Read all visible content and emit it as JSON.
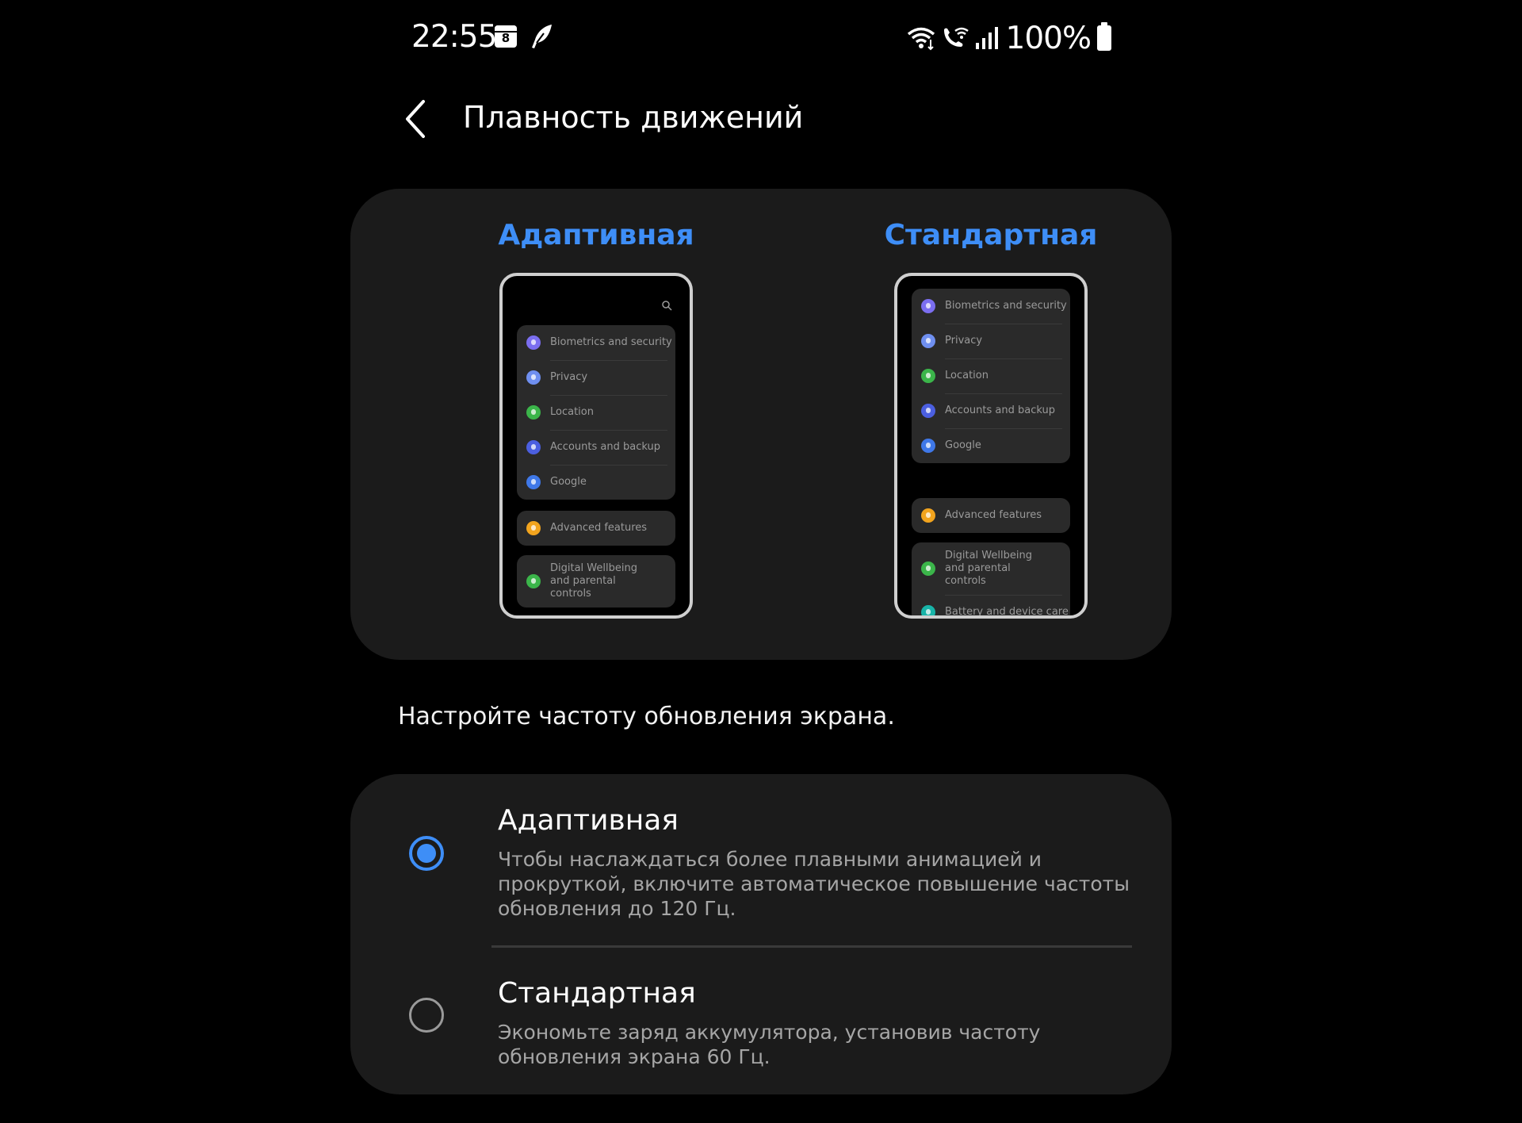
{
  "status_bar": {
    "time": "22:55",
    "calendar_day": "8",
    "battery": "100%",
    "icons": [
      "calendar-icon",
      "feather-icon",
      "wifi-icon",
      "wifi-call-icon",
      "signal-icon",
      "battery-icon"
    ]
  },
  "header": {
    "title": "Плавность движений",
    "back_icon": "chevron-left-icon"
  },
  "preview": {
    "adaptive_label": "Адаптивная",
    "standard_label": "Стандартная",
    "accent_color": "#3e8ef7",
    "adaptive_phone": {
      "group1": [
        {
          "label": "Biometrics and security",
          "icon_color": "#7b6ef0"
        },
        {
          "label": "Privacy",
          "icon_color": "#6f8ff0"
        },
        {
          "label": "Location",
          "icon_color": "#3bb54a"
        },
        {
          "label": "Accounts and backup",
          "icon_color": "#4b5fe0"
        },
        {
          "label": "Google",
          "icon_color": "#3f78e8"
        }
      ],
      "group2": [
        {
          "label": "Advanced features",
          "icon_color": "#f2a41e"
        }
      ],
      "group3": [
        {
          "label": "Digital Wellbeing and parental controls",
          "icon_color": "#3bb54a"
        }
      ]
    },
    "standard_phone": {
      "group1": [
        {
          "label": "Biometrics and security",
          "icon_color": "#7b6ef0"
        },
        {
          "label": "Privacy",
          "icon_color": "#6f8ff0"
        },
        {
          "label": "Location",
          "icon_color": "#3bb54a"
        },
        {
          "label": "Accounts and backup",
          "icon_color": "#4b5fe0"
        },
        {
          "label": "Google",
          "icon_color": "#3f78e8"
        }
      ],
      "group2": [
        {
          "label": "Advanced features",
          "icon_color": "#f2a41e"
        }
      ],
      "group3": [
        {
          "label": "Digital Wellbeing and parental controls",
          "icon_color": "#3bb54a"
        },
        {
          "label": "Battery and device care",
          "icon_color": "#18b4a8"
        }
      ]
    }
  },
  "description": "Настройте частоту обновления экрана.",
  "options": [
    {
      "title": "Адаптивная",
      "subtitle": "Чтобы наслаждаться более плавными анимацией и прокруткой, включите автоматическое повышение частоты обновления до 120 Гц.",
      "selected": true
    },
    {
      "title": "Стандартная",
      "subtitle": "Экономьте заряд аккумулятора, установив частоту обновления экрана 60 Гц.",
      "selected": false
    }
  ]
}
